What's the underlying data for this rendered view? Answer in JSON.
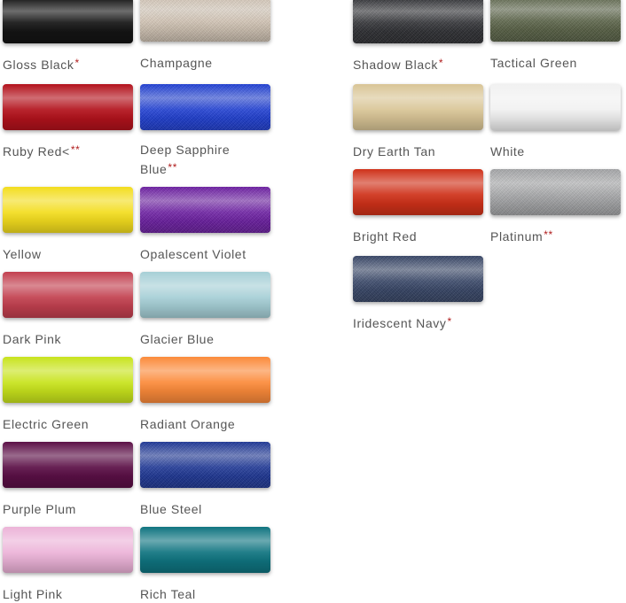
{
  "swatches": [
    {
      "name": "Gloss Black",
      "mark": "*",
      "color": "#141414",
      "metallic": false
    },
    {
      "name": "Champagne",
      "mark": "",
      "color": "#d4c6b6",
      "metallic": true
    },
    {
      "name": "Ruby Red<",
      "mark": "**",
      "color": "#b3121c",
      "metallic": true
    },
    {
      "name": "Deep Sapphire Blue",
      "mark": "**",
      "color": "#1e3fd8",
      "metallic": true
    },
    {
      "name": "Yellow",
      "mark": "",
      "color": "#f3dd1e",
      "metallic": false
    },
    {
      "name": "Opalescent Violet",
      "mark": "",
      "color": "#6e1ea6",
      "metallic": true
    },
    {
      "name": "Dark Pink",
      "mark": "",
      "color": "#c2404f",
      "metallic": false
    },
    {
      "name": "Glacier Blue",
      "mark": "",
      "color": "#a6cfd6",
      "metallic": false
    },
    {
      "name": "Electric Green",
      "mark": "",
      "color": "#c8e31c",
      "metallic": false
    },
    {
      "name": "Radiant Orange",
      "mark": "",
      "color": "#fb8a3a",
      "metallic": false
    },
    {
      "name": "Purple Plum",
      "mark": "",
      "color": "#5b0f46",
      "metallic": false
    },
    {
      "name": "Blue Steel",
      "mark": "",
      "color": "#1d3799",
      "metallic": true
    },
    {
      "name": "Light Pink",
      "mark": "",
      "color": "#ecb3d8",
      "metallic": false
    },
    {
      "name": "Rich Teal",
      "mark": "",
      "color": "#0f7480",
      "metallic": false
    },
    {
      "name": "Shadow Black",
      "mark": "*",
      "color": "#2e2f33",
      "metallic": true
    },
    {
      "name": "Tactical Green",
      "mark": "",
      "color": "#5a6347",
      "metallic": true
    },
    {
      "name": "Dry Earth Tan",
      "mark": "",
      "color": "#d9c596",
      "metallic": false
    },
    {
      "name": "White",
      "mark": "",
      "color": "#f1f1f1",
      "metallic": false
    },
    {
      "name": "Bright Red",
      "mark": "",
      "color": "#cf3119",
      "metallic": false
    },
    {
      "name": "Platinum",
      "mark": "**",
      "color": "#a7a8aa",
      "metallic": true
    },
    {
      "name": "Iridescent Navy",
      "mark": "*",
      "color": "#374668",
      "metallic": true
    }
  ]
}
